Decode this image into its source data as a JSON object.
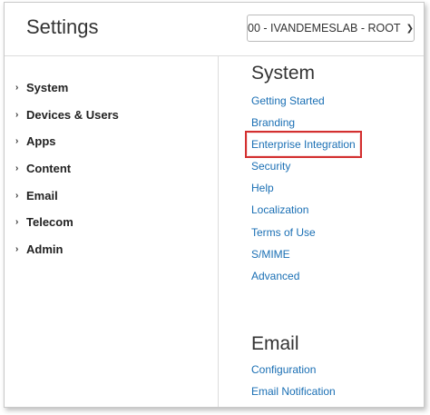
{
  "header": {
    "title": "Settings",
    "tenant_select_value": "00 - IVANDEMESLAB - ROOT"
  },
  "nav": {
    "items": [
      {
        "label": "System"
      },
      {
        "label": "Devices & Users"
      },
      {
        "label": "Apps"
      },
      {
        "label": "Content"
      },
      {
        "label": "Email"
      },
      {
        "label": "Telecom"
      },
      {
        "label": "Admin"
      }
    ]
  },
  "sections": {
    "system": {
      "title": "System",
      "links": [
        {
          "label": "Getting Started"
        },
        {
          "label": "Branding"
        },
        {
          "label": "Enterprise Integration",
          "highlighted": true
        },
        {
          "label": "Security"
        },
        {
          "label": "Help"
        },
        {
          "label": "Localization"
        },
        {
          "label": "Terms of Use"
        },
        {
          "label": "S/MIME"
        },
        {
          "label": "Advanced"
        }
      ]
    },
    "email": {
      "title": "Email",
      "links": [
        {
          "label": "Configuration"
        },
        {
          "label": "Email Notification"
        }
      ]
    }
  },
  "icons": {
    "nav_chevron": "chevron-right-icon",
    "select_chevron": "chevron-down-icon"
  },
  "colors": {
    "link": "#1a6fb4",
    "highlight_border": "#d32f2f"
  }
}
